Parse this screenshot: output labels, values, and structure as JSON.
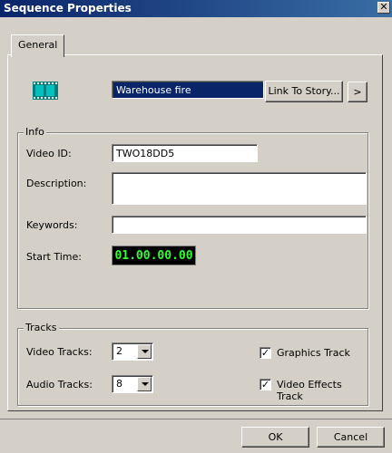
{
  "window": {
    "title": "Sequence Properties",
    "close_glyph": "✕"
  },
  "tabs": [
    {
      "label": "General"
    }
  ],
  "header": {
    "sequence_name": "Warehouse fire",
    "link_button": "Link To Story...",
    "next_button": ">"
  },
  "info": {
    "legend": "Info",
    "video_id_label": "Video ID:",
    "video_id": "TWO18DD5",
    "description_label": "Description:",
    "description": "",
    "keywords_label": "Keywords:",
    "keywords": "",
    "start_time_label": "Start Time:",
    "start_time": "01.00.00.00"
  },
  "tracks": {
    "legend": "Tracks",
    "video_tracks_label": "Video Tracks:",
    "video_tracks": "2",
    "audio_tracks_label": "Audio Tracks:",
    "audio_tracks": "8",
    "graphics_track_label": "Graphics Track",
    "graphics_track_checked": true,
    "video_effects_label": "Video Effects Track",
    "video_effects_checked": true
  },
  "footer": {
    "ok": "OK",
    "cancel": "Cancel"
  },
  "colors": {
    "titlebar": "#0a246a",
    "timecode_bg": "#000000",
    "timecode_fg": "#33ff33"
  }
}
